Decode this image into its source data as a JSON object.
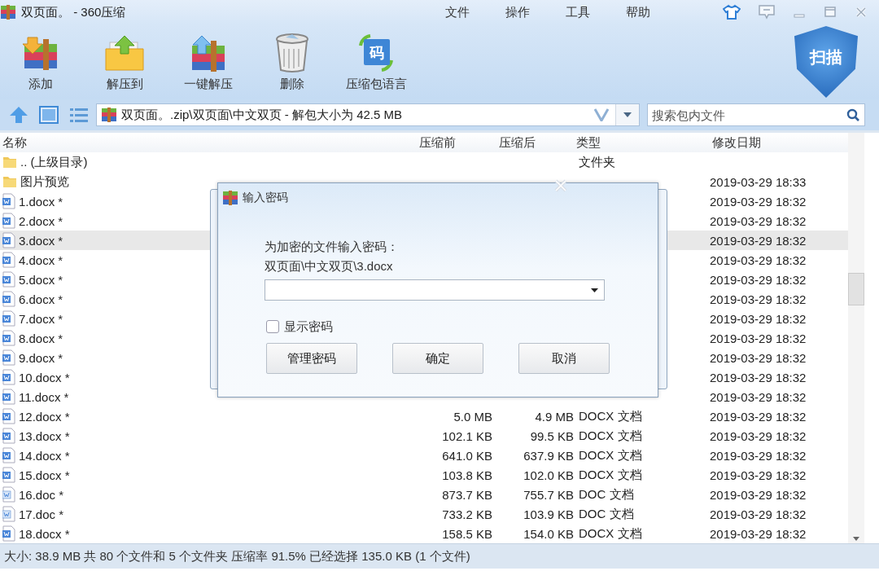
{
  "window": {
    "title": "双页面。 - 360压缩"
  },
  "menu": [
    "文件",
    "操作",
    "工具",
    "帮助"
  ],
  "toolbar": [
    {
      "kind": "add",
      "label": "添加"
    },
    {
      "kind": "extract",
      "label": "解压到"
    },
    {
      "kind": "oneclick",
      "label": "一键解压"
    },
    {
      "kind": "delete",
      "label": "删除"
    },
    {
      "kind": "language",
      "label": "压缩包语言",
      "icon_label": "码"
    }
  ],
  "scan_button": "扫描",
  "address": {
    "path": "双页面。.zip\\双页面\\中文双页 - 解包大小为 42.5 MB"
  },
  "search": {
    "placeholder": "搜索包内文件"
  },
  "table": {
    "columns": [
      "名称",
      "压缩前",
      "压缩后",
      "类型",
      "修改日期"
    ],
    "rows": [
      {
        "kind": "folder",
        "name": ".. (上级目录)",
        "type": "文件夹",
        "selected": false
      },
      {
        "kind": "folder",
        "name": "图片预览",
        "date": "2019-03-29 18:33",
        "selected": false
      },
      {
        "kind": "docx",
        "name": "1.docx *",
        "date": "2019-03-29 18:32",
        "selected": false
      },
      {
        "kind": "docx",
        "name": "2.docx *",
        "date": "2019-03-29 18:32",
        "selected": false
      },
      {
        "kind": "docx",
        "name": "3.docx *",
        "date": "2019-03-29 18:32",
        "selected": true
      },
      {
        "kind": "docx",
        "name": "4.docx *",
        "date": "2019-03-29 18:32",
        "selected": false
      },
      {
        "kind": "docx",
        "name": "5.docx *",
        "date": "2019-03-29 18:32",
        "selected": false
      },
      {
        "kind": "docx",
        "name": "6.docx *",
        "date": "2019-03-29 18:32",
        "selected": false
      },
      {
        "kind": "docx",
        "name": "7.docx *",
        "date": "2019-03-29 18:32",
        "selected": false
      },
      {
        "kind": "docx",
        "name": "8.docx *",
        "date": "2019-03-29 18:32",
        "selected": false
      },
      {
        "kind": "docx",
        "name": "9.docx *",
        "date": "2019-03-29 18:32",
        "selected": false
      },
      {
        "kind": "docx",
        "name": "10.docx *",
        "date": "2019-03-29 18:32",
        "selected": false
      },
      {
        "kind": "docx",
        "name": "11.docx *",
        "date": "2019-03-29 18:32",
        "selected": false
      },
      {
        "kind": "docx",
        "name": "12.docx *",
        "size": "5.0 MB",
        "packed": "4.9 MB",
        "type": "DOCX 文档",
        "date": "2019-03-29 18:32",
        "selected": false
      },
      {
        "kind": "docx",
        "name": "13.docx *",
        "size": "102.1 KB",
        "packed": "99.5 KB",
        "type": "DOCX 文档",
        "date": "2019-03-29 18:32",
        "selected": false
      },
      {
        "kind": "docx",
        "name": "14.docx *",
        "size": "641.0 KB",
        "packed": "637.9 KB",
        "type": "DOCX 文档",
        "date": "2019-03-29 18:32",
        "selected": false
      },
      {
        "kind": "docx",
        "name": "15.docx *",
        "size": "103.8 KB",
        "packed": "102.0 KB",
        "type": "DOCX 文档",
        "date": "2019-03-29 18:32",
        "selected": false
      },
      {
        "kind": "doc",
        "name": "16.doc *",
        "size": "873.7 KB",
        "packed": "755.7 KB",
        "type": "DOC 文档",
        "date": "2019-03-29 18:32",
        "selected": false
      },
      {
        "kind": "doc",
        "name": "17.doc *",
        "size": "733.2 KB",
        "packed": "103.9 KB",
        "type": "DOC 文档",
        "date": "2019-03-29 18:32",
        "selected": false
      },
      {
        "kind": "docx",
        "name": "18.docx *",
        "size": "158.5 KB",
        "packed": "154.0 KB",
        "type": "DOCX 文档",
        "date": "2019-03-29 18:32",
        "selected": false
      }
    ]
  },
  "status_bar": "大小: 38.9 MB 共 80 个文件和 5 个文件夹 压缩率 91.5% 已经选择 135.0 KB (1 个文件)",
  "dialog": {
    "title": "输入密码",
    "prompt": "为加密的文件输入密码：",
    "file": "双页面\\中文双页\\3.docx",
    "show_password": {
      "label": "显示密码",
      "checked": false
    },
    "buttons": [
      "管理密码",
      "确定",
      "取消"
    ]
  }
}
